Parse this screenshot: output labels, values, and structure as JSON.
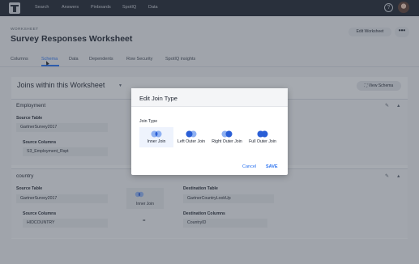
{
  "nav": {
    "items": [
      "Search",
      "Answers",
      "Pinboards",
      "SpotIQ",
      "Data"
    ],
    "help_icon": "question-circle-icon"
  },
  "header": {
    "breadcrumb": "WORKSHEET",
    "title": "Survey Responses Worksheet",
    "edit_button": "Edit Worksheet",
    "more_button": "•••"
  },
  "tabs": [
    "Columns",
    "Schema",
    "Data",
    "Dependents",
    "Row Security",
    "SpotIQ insights"
  ],
  "active_tab": "Schema",
  "joins": {
    "title": "Joins within this Worksheet",
    "view_schema": "View Schema",
    "cards": [
      {
        "name": "Employment",
        "source_table_label": "Source Table",
        "source_table": "GartnerSurvey2017",
        "source_columns_label": "Source Columns",
        "source_column": "S3_Employment_Rspt"
      },
      {
        "name": "country",
        "source_table_label": "Source Table",
        "source_table": "GartnerSurvey2017",
        "source_columns_label": "Source Columns",
        "source_column": "HIDCOUNTRY",
        "join_type": "Inner Join",
        "equals": "=",
        "dest_table_label": "Destination Table",
        "dest_table": "GartnerCountryLookUp",
        "dest_columns_label": "Destination Columns",
        "dest_column": "CountryID"
      }
    ]
  },
  "modal": {
    "title": "Edit Join Type",
    "join_type_label": "Join Type",
    "options": [
      "Inner Join",
      "Left Outer Join",
      "Right Outer Join",
      "Full Outer Join"
    ],
    "selected": "Inner Join",
    "cancel": "Cancel",
    "save": "SAVE"
  },
  "colors": {
    "nav_bg": "#1d232f",
    "accent": "#2770ef",
    "venn_dark": "#2b5fd6",
    "venn_light": "#8fb1f2"
  }
}
